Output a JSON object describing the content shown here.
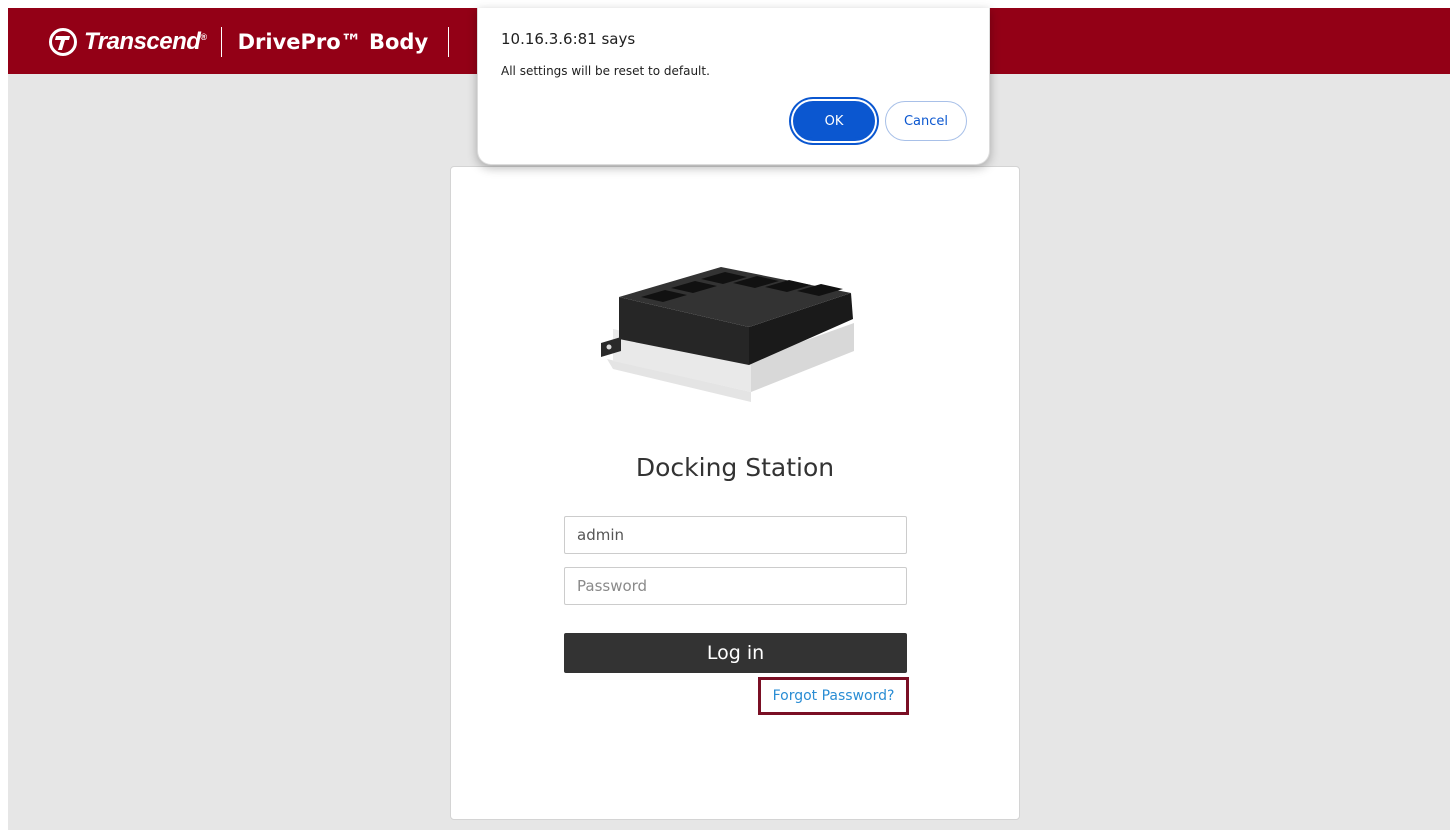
{
  "header": {
    "brand_name": "Transcend",
    "brand_mark": "®",
    "product_name": "DrivePro™ Body",
    "accent_color": "#930016"
  },
  "login": {
    "title": "Docking Station",
    "username_value": "admin",
    "password_placeholder": "Password",
    "login_label": "Log in",
    "forgot_label": "Forgot Password?",
    "image_icon": "docking-station-image"
  },
  "dialog": {
    "title": "10.16.3.6:81 says",
    "message": "All settings will be reset to default.",
    "ok_label": "OK",
    "cancel_label": "Cancel",
    "button_color": "#0b57d0"
  }
}
